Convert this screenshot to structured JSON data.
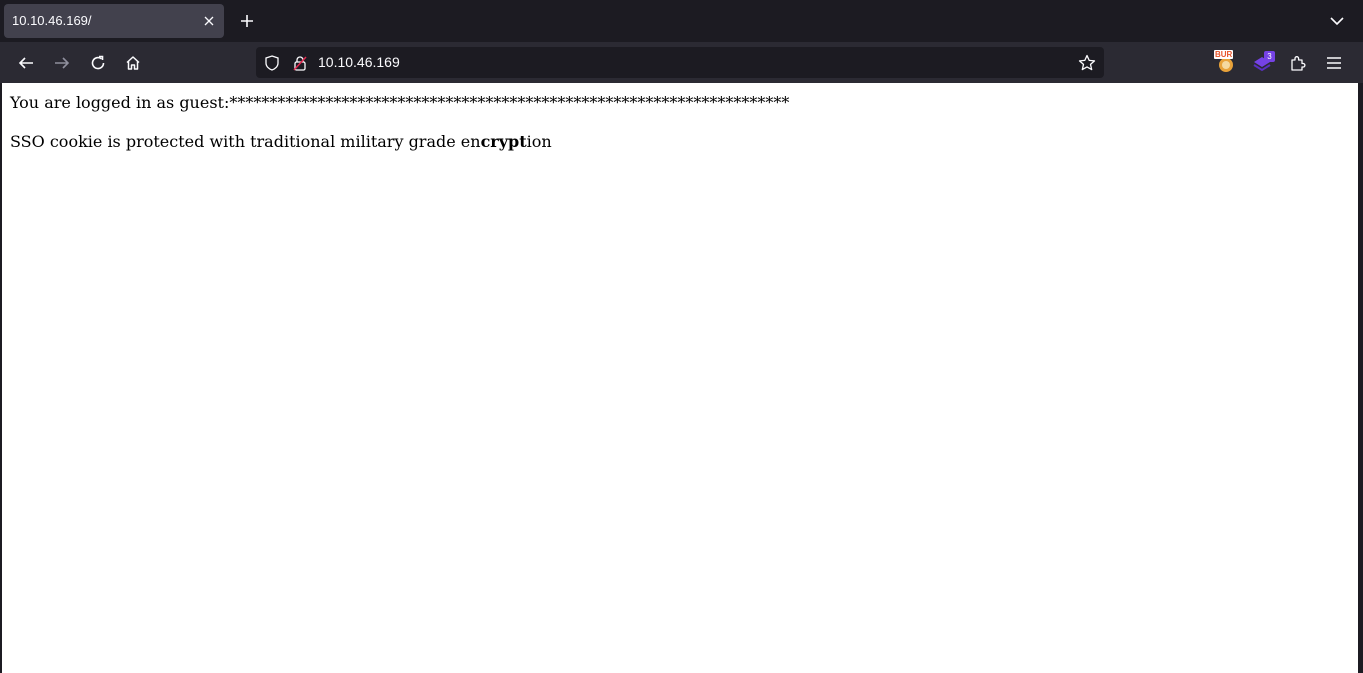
{
  "tab": {
    "title": "10.10.46.169/"
  },
  "navbar": {
    "url": "10.10.46.169",
    "extensions": [
      {
        "name": "burp-extension",
        "label": "BUR"
      },
      {
        "name": "container-extension",
        "badge": "3"
      }
    ]
  },
  "page": {
    "line1": "You are logged in as guest:**********************************************************************",
    "line2_prefix": "SSO cookie is protected with traditional military grade en",
    "line2_bold": "crypt",
    "line2_suffix": "ion"
  },
  "colors": {
    "toolbar_bg": "#2b2a33",
    "tabstrip_bg": "#1c1b22",
    "tab_active_bg": "#42414d",
    "urlbar_bg": "#1c1b22",
    "text_light": "#fbfbfe",
    "content_bg": "#ffffff"
  },
  "icons": [
    "close-icon",
    "plus-icon",
    "chevron-down-icon",
    "back-arrow-icon",
    "forward-arrow-icon",
    "reload-icon",
    "home-icon",
    "shield-icon",
    "lock-icon",
    "star-icon",
    "puzzle-icon",
    "hamburger-menu-icon"
  ]
}
